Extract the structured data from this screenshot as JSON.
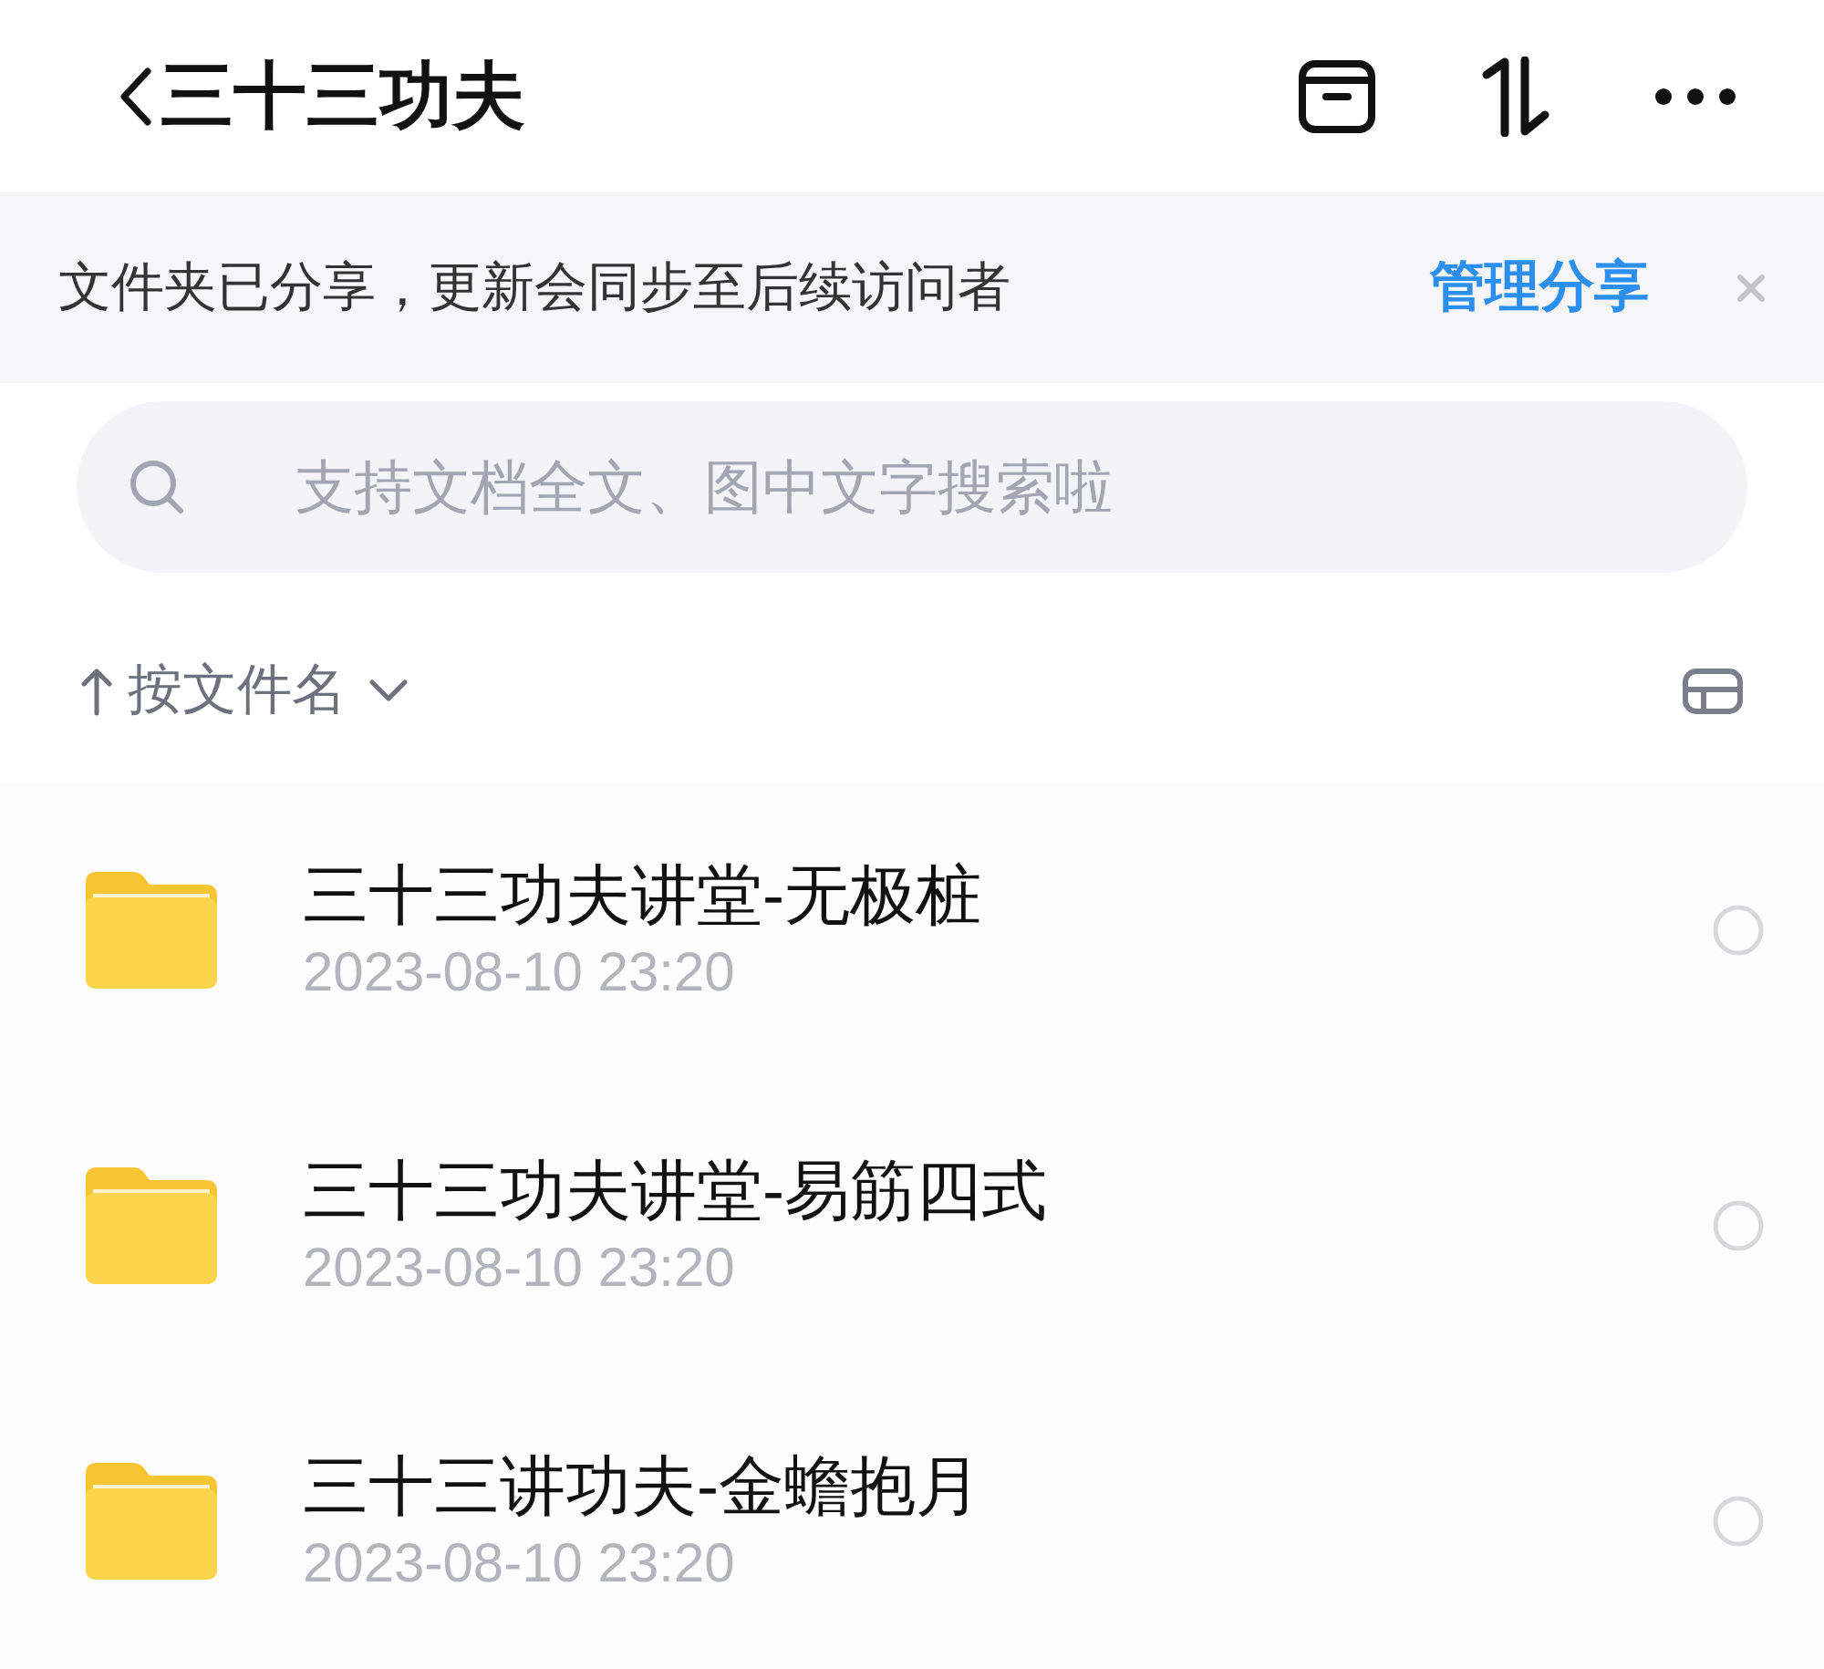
{
  "header": {
    "title": "三十三功夫"
  },
  "share_banner": {
    "message": "文件夹已分享，更新会同步至后续访问者",
    "action": "管理分享"
  },
  "search": {
    "placeholder": "支持文档全文、图中文字搜索啦"
  },
  "sort": {
    "label": "按文件名"
  },
  "files": [
    {
      "name": "三十三功夫讲堂-无极桩",
      "modified": "2023-08-10 23:20",
      "selected": false
    },
    {
      "name": "三十三功夫讲堂-易筋四式",
      "modified": "2023-08-10 23:20",
      "selected": false
    },
    {
      "name": "三十三讲功夫-金蟾抱月",
      "modified": "2023-08-10 23:20",
      "selected": false
    }
  ]
}
